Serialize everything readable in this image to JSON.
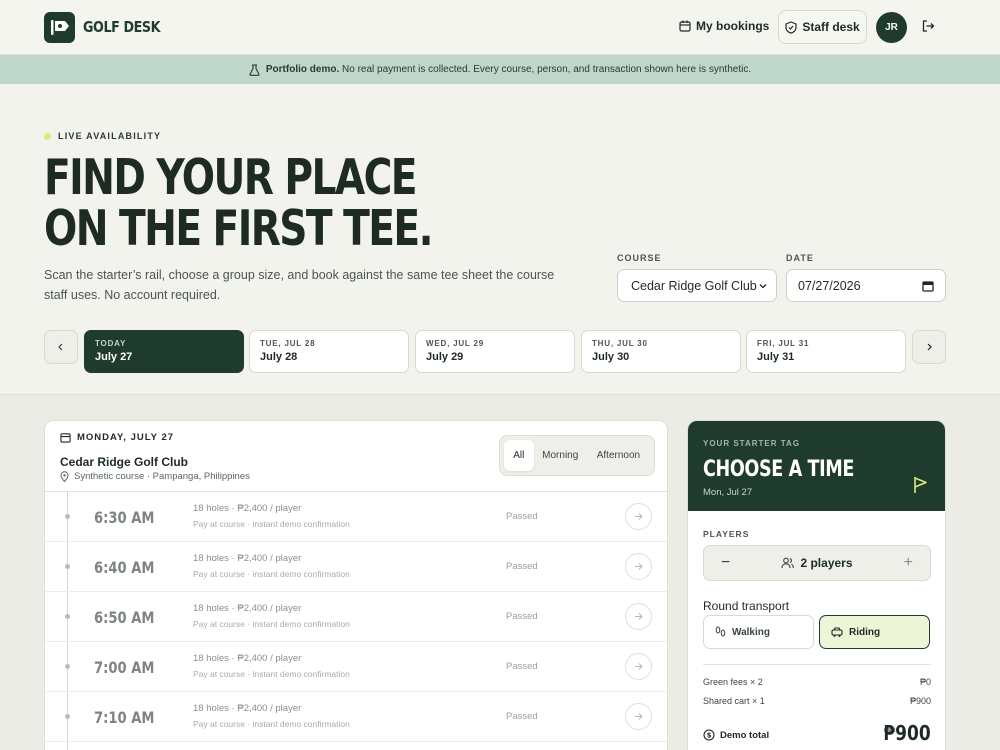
{
  "header": {
    "brand": "GOLF DESK",
    "nav_bookings": "My bookings",
    "nav_staff": "Staff desk",
    "avatar_initials": "JR"
  },
  "banner": {
    "strong": "Portfolio demo.",
    "text": "No real payment is collected. Every course, person, and transaction shown here is synthetic."
  },
  "hero": {
    "kicker": "LIVE AVAILABILITY",
    "title_line1": "FIND YOUR PLACE",
    "title_line2": "ON THE FIRST TEE.",
    "subtitle": "Scan the starter’s rail, choose a group size, and book against the same tee sheet the course staff uses. No account required."
  },
  "filters": {
    "course_label": "COURSE",
    "course_value": "Cedar Ridge Golf Club",
    "date_label": "DATE",
    "date_value": "07/27/2026"
  },
  "days": [
    {
      "top": "TODAY",
      "main": "July 27"
    },
    {
      "top": "TUE, JUL 28",
      "main": "July 28"
    },
    {
      "top": "WED, JUL 29",
      "main": "July 29"
    },
    {
      "top": "THU, JUL 30",
      "main": "July 30"
    },
    {
      "top": "FRI, JUL 31",
      "main": "July 31"
    }
  ],
  "sheet": {
    "date": "MONDAY, JULY 27",
    "club": "Cedar Ridge Golf Club",
    "location": "Synthetic course · Pampanga, Philippines",
    "filters": [
      "All",
      "Morning",
      "Afternoon"
    ],
    "slots": [
      {
        "time": "6:30 AM",
        "line1": "18 holes · ₱2,400 / player",
        "line2": "Pay at course · instant demo confirmation",
        "status": "Passed"
      },
      {
        "time": "6:40 AM",
        "line1": "18 holes · ₱2,400 / player",
        "line2": "Pay at course · instant demo confirmation",
        "status": "Passed"
      },
      {
        "time": "6:50 AM",
        "line1": "18 holes · ₱2,400 / player",
        "line2": "Pay at course · instant demo confirmation",
        "status": "Passed"
      },
      {
        "time": "7:00 AM",
        "line1": "18 holes · ₱2,400 / player",
        "line2": "Pay at course · instant demo confirmation",
        "status": "Passed"
      },
      {
        "time": "7:10 AM",
        "line1": "18 holes · ₱2,400 / player",
        "line2": "Pay at course · instant demo confirmation",
        "status": "Passed"
      }
    ]
  },
  "tag": {
    "kicker": "YOUR STARTER TAG",
    "title": "CHOOSE A TIME",
    "date": "Mon, Jul 27",
    "players_label": "PLAYERS",
    "players_value": "2 players",
    "transport_label": "Round transport",
    "walking": "Walking",
    "riding": "Riding",
    "fees": [
      {
        "label": "Green fees × 2",
        "amount": "₱0"
      },
      {
        "label": "Shared cart × 1",
        "amount": "₱900"
      }
    ],
    "total_label": "Demo total",
    "total_amount": "₱900"
  },
  "colors": {
    "primary": "#1f3b2e",
    "banner": "#bfd6cc",
    "accent": "#d7ec7a",
    "background": "#f3f3ee"
  }
}
